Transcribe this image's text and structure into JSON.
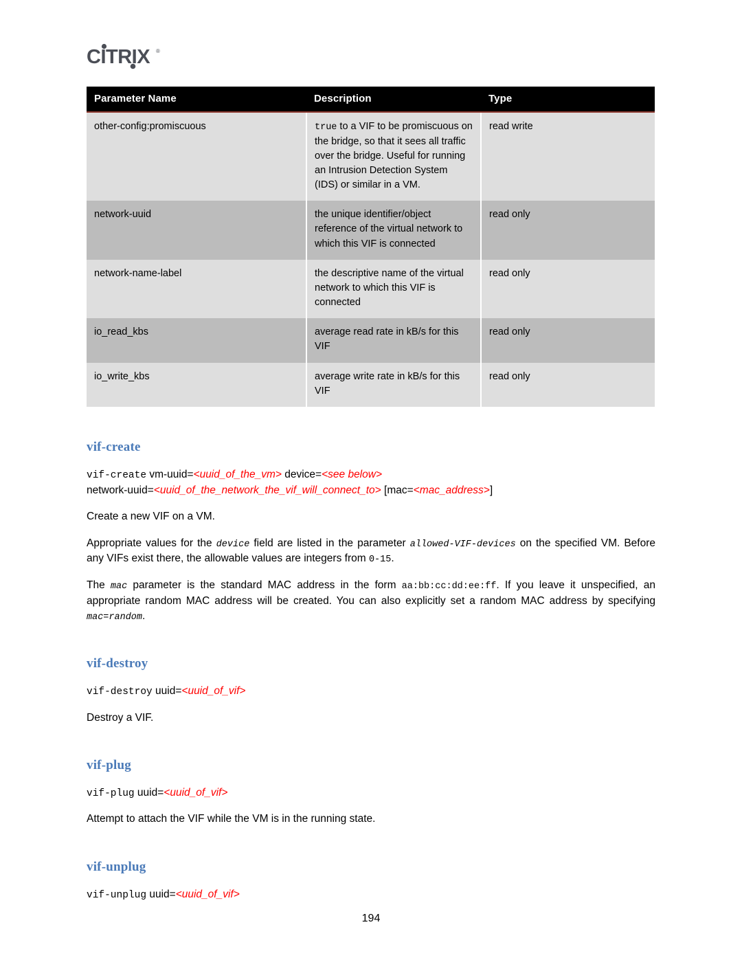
{
  "brand": {
    "logo_text": "CITRIX",
    "logo_mark": "®",
    "logo_color": "#4b4e56"
  },
  "table": {
    "headers": [
      "Parameter Name",
      "Description",
      "Type"
    ],
    "rows": [
      {
        "name": "other-config:promiscuous",
        "desc_prefix_mono": "true",
        "desc": " to a VIF to be promiscuous on the bridge, so that it sees all traffic over the bridge. Useful for running an Intrusion Detection System (IDS) or similar in a VM.",
        "type": "read write"
      },
      {
        "name": "network-uuid",
        "desc_prefix_mono": "",
        "desc": "the unique identifier/object reference of the virtual network to which this VIF is connected",
        "type": "read only"
      },
      {
        "name": "network-name-label",
        "desc_prefix_mono": "",
        "desc": "the descriptive name of the virtual network to which this VIF is connected",
        "type": "read only"
      },
      {
        "name": "io_read_kbs",
        "desc_prefix_mono": "",
        "desc": "average read rate in kB/s for this VIF",
        "type": "read only"
      },
      {
        "name": "io_write_kbs",
        "desc_prefix_mono": "",
        "desc": "average write rate in kB/s for this VIF",
        "type": "read only"
      }
    ]
  },
  "sections": {
    "vif_create": {
      "heading": "vif-create",
      "cmd_name": "vif-create",
      "cmd_arg1": " vm-uuid=",
      "cmd_ph1": "<uuid_of_the_vm>",
      "cmd_arg2": " device=",
      "cmd_ph2": "<see below>",
      "cmd_line2_arg1": "network-uuid=",
      "cmd_line2_ph1": "<uuid_of_the_network_the_vif_will_connect_to>",
      "cmd_line2_arg2": " [mac=",
      "cmd_line2_ph2": "<mac_address>",
      "cmd_line2_arg3": "]",
      "para1": "Create a new VIF on a VM.",
      "para2_a": "Appropriate values for the ",
      "para2_mono1": "device",
      "para2_b": " field are listed in the parameter ",
      "para2_mono2": "allowed-VIF-devices",
      "para2_c": " on the specified VM. Before any VIFs exist there, the allowable values are integers from ",
      "para2_mono3": "0-15",
      "para2_d": ".",
      "para3_a": "The ",
      "para3_mono1": "mac",
      "para3_b": " parameter is the standard MAC address in the form ",
      "para3_mono2": "aa:bb:cc:dd:ee:ff",
      "para3_c": ". If you leave it unspecified, an appropriate random MAC address will be created. You can also explicitly set a random MAC address by specifying ",
      "para3_mono3": "mac=random",
      "para3_d": "."
    },
    "vif_destroy": {
      "heading": "vif-destroy",
      "cmd_name": "vif-destroy",
      "cmd_arg1": " uuid=",
      "cmd_ph1": "<uuid_of_vif>",
      "para1": "Destroy a VIF."
    },
    "vif_plug": {
      "heading": "vif-plug",
      "cmd_name": "vif-plug",
      "cmd_arg1": " uuid=",
      "cmd_ph1": "<uuid_of_vif>",
      "para1": "Attempt to attach the VIF while the VM is in the running state."
    },
    "vif_unplug": {
      "heading": "vif-unplug",
      "cmd_name": "vif-unplug",
      "cmd_arg1": " uuid=",
      "cmd_ph1": "<uuid_of_vif>"
    }
  },
  "footer": {
    "page_number": "194"
  },
  "colors": {
    "heading_blue": "#4a7ab8",
    "placeholder_red": "#ff0000",
    "table_header_bg": "#000000",
    "band_light": "#dedede",
    "band_dark": "#bcbcbc",
    "header_rule": "#8d3a30"
  }
}
